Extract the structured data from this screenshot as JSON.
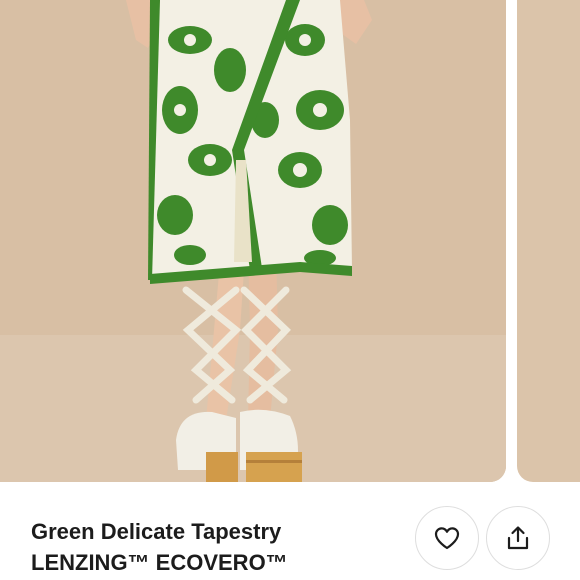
{
  "listing": {
    "title_lines": [
      "Green Delicate Tapestry",
      "LENZING™ ECOVERO™"
    ]
  },
  "images": {
    "main": "Model wearing a green and white floral tapestry print midi wrap skirt with cream lace-up ankle-tie platform sandals",
    "next": "Next product photo (partially visible)"
  },
  "actions": {
    "like_icon": "heart-icon",
    "share_icon": "share-icon"
  },
  "colors": {
    "backdrop": "#d8bfa4",
    "skirt_green": "#3f8a2b",
    "skirt_cream": "#f3f0e4",
    "text": "#1c1c1c",
    "button_border": "#dedede"
  }
}
